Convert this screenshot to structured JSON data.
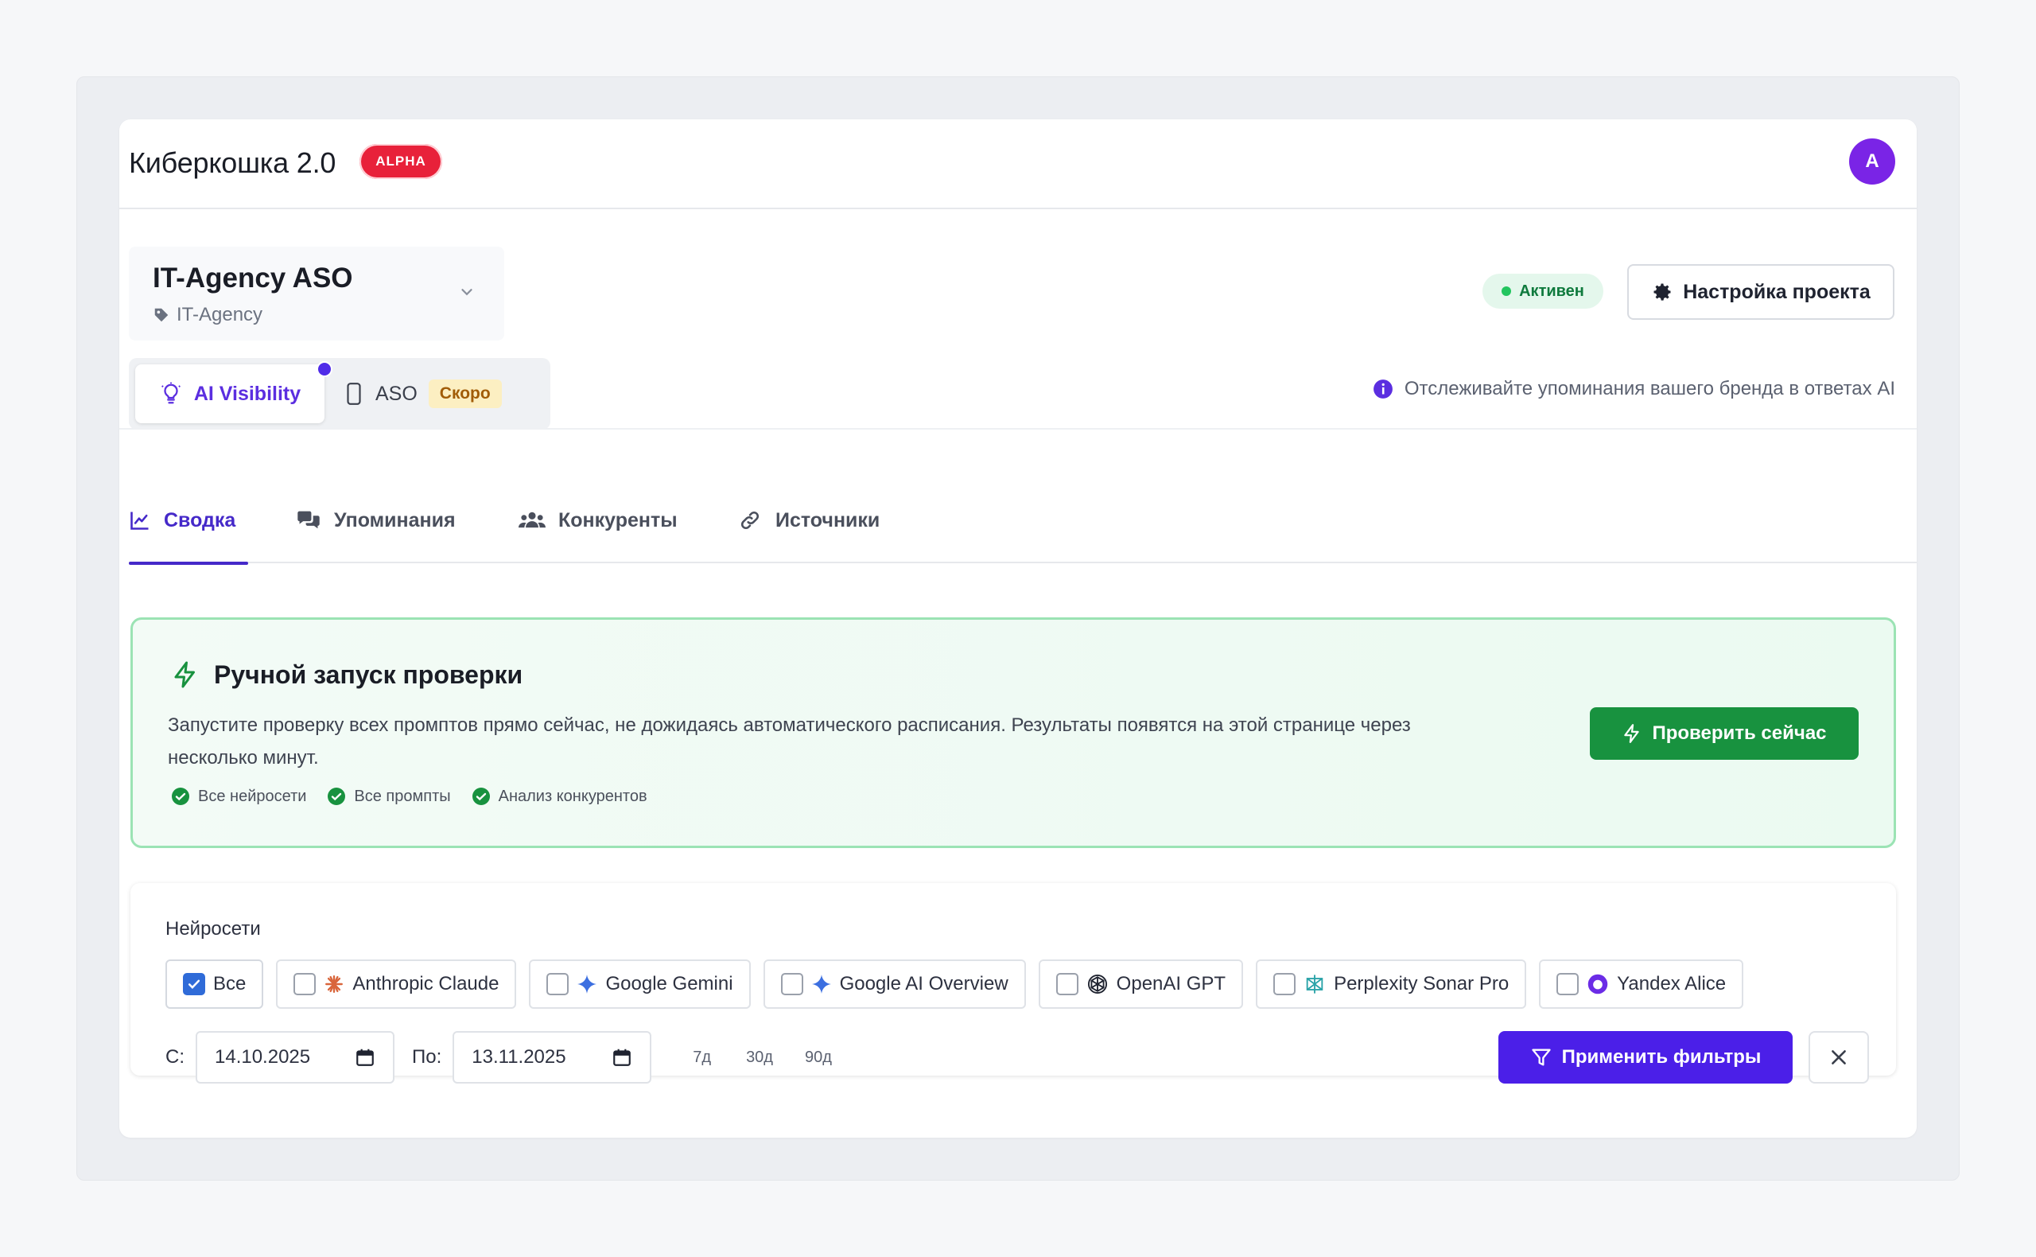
{
  "header": {
    "title": "Киберкошка 2.0",
    "badge": "ALPHA",
    "avatar_initial": "A"
  },
  "project": {
    "name": "IT-Agency ASO",
    "category": "IT-Agency",
    "status": "Активен",
    "settings_label": "Настройка проекта"
  },
  "modules": {
    "ai_visibility": "AI Visibility",
    "aso": "ASO",
    "aso_badge": "Скоро",
    "hint": "Отслеживайте упоминания вашего бренда в ответах AI"
  },
  "tabs": [
    "Сводка",
    "Упоминания",
    "Конкуренты",
    "Источники"
  ],
  "manual_run": {
    "title": "Ручной запуск проверки",
    "description": "Запустите проверку всех промптов прямо сейчас, не дожидаясь автоматического расписания. Результаты появятся на этой странице через несколько минут.",
    "checks": [
      "Все нейросети",
      "Все промпты",
      "Анализ конкурентов"
    ],
    "button": "Проверить сейчас"
  },
  "filters": {
    "label": "Нейросети",
    "models": [
      {
        "label": "Все",
        "checked": true
      },
      {
        "label": "Anthropic Claude",
        "checked": false
      },
      {
        "label": "Google Gemini",
        "checked": false
      },
      {
        "label": "Google AI Overview",
        "checked": false
      },
      {
        "label": "OpenAI GPT",
        "checked": false
      },
      {
        "label": "Perplexity Sonar Pro",
        "checked": false
      },
      {
        "label": "Yandex Alice",
        "checked": false
      }
    ],
    "from_label": "С:",
    "from_value": "14.10.2025",
    "to_label": "По:",
    "to_value": "13.11.2025",
    "quick": [
      "7д",
      "30д",
      "90д"
    ],
    "apply": "Применить фильтры"
  },
  "colors": {
    "accent": "#4b1fe8",
    "green": "#18923f",
    "alpha": "#e8213a",
    "avatar": "#7a24e6"
  }
}
